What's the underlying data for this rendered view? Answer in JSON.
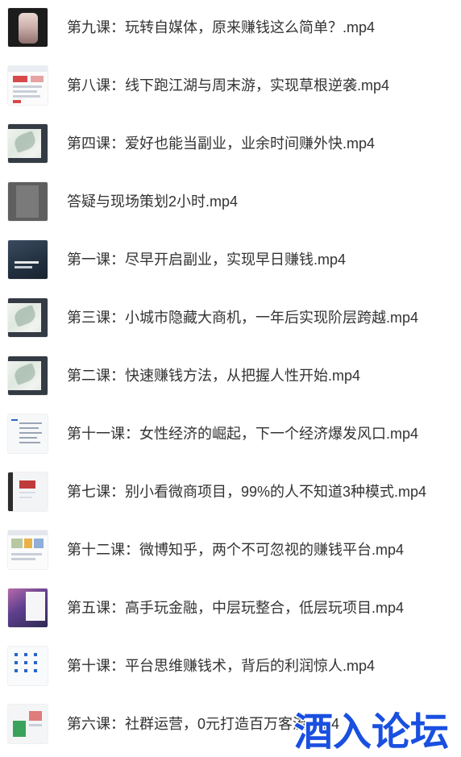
{
  "files": [
    {
      "name": "第九课：玩转自媒体，原来赚钱这么简单？.mp4",
      "thumbnail": "video-frame-thumbnail"
    },
    {
      "name": "第八课：线下跑江湖与周末游，实现草根逆袭.mp4",
      "thumbnail": "webpage-thumbnail"
    },
    {
      "name": "第四课：爱好也能当副业，业余时间赚外快.mp4",
      "thumbnail": "slide-thumbnail"
    },
    {
      "name": "答疑与现场策划2小时.mp4",
      "thumbnail": "gray-screen-thumbnail"
    },
    {
      "name": "第一课：尽早开启副业，实现早日赚钱.mp4",
      "thumbnail": "dark-slide-thumbnail"
    },
    {
      "name": "第三课：小城市隐藏大商机，一年后实现阶层跨越.mp4",
      "thumbnail": "slide-thumbnail"
    },
    {
      "name": "第二课：快速赚钱方法，从把握人性开始.mp4",
      "thumbnail": "slide-thumbnail"
    },
    {
      "name": "第十一课：女性经济的崛起，下一个经济爆发风口.mp4",
      "thumbnail": "document-thumbnail"
    },
    {
      "name": "第七课：别小看微商项目，99%的人不知道3种模式.mp4",
      "thumbnail": "phone-app-thumbnail"
    },
    {
      "name": "第十二课：微博知乎，两个不可忽视的赚钱平台.mp4",
      "thumbnail": "weibo-page-thumbnail"
    },
    {
      "name": "第五课：高手玩金融，中层玩整合，低层玩项目.mp4",
      "thumbnail": "purple-desktop-thumbnail"
    },
    {
      "name": "第十课：平台思维赚钱术，背后的利润惊人.mp4",
      "thumbnail": "table-thumbnail"
    },
    {
      "name": "第六课：社群运营，0元打造百万客流.mp4",
      "thumbnail": "green-poster-thumbnail"
    }
  ],
  "watermark": {
    "text": "酒入论坛",
    "color": "#1a4fe0"
  },
  "colors": {
    "text": "#333333",
    "background": "#ffffff"
  }
}
